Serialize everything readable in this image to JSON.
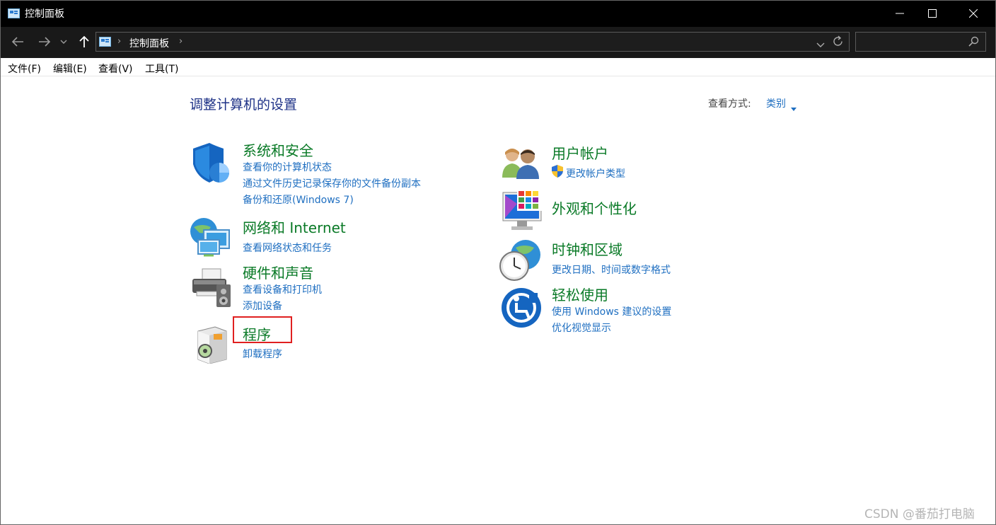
{
  "window": {
    "title": "控制面板"
  },
  "address": {
    "path": "控制面板"
  },
  "search": {
    "placeholder": ""
  },
  "menu": [
    "文件(F)",
    "编辑(E)",
    "查看(V)",
    "工具(T)"
  ],
  "content": {
    "heading": "调整计算机的设置",
    "view_label": "查看方式:",
    "view_value": "类别"
  },
  "categories": {
    "security": {
      "title": "系统和安全",
      "links": [
        "查看你的计算机状态",
        "通过文件历史记录保存你的文件备份副本",
        "备份和还原(Windows 7)"
      ]
    },
    "network": {
      "title": "网络和 Internet",
      "links": [
        "查看网络状态和任务"
      ]
    },
    "hardware": {
      "title": "硬件和声音",
      "links": [
        "查看设备和打印机",
        "添加设备"
      ]
    },
    "programs": {
      "title": "程序",
      "links": [
        "卸载程序"
      ]
    },
    "accounts": {
      "title": "用户帐户",
      "links": [
        "更改帐户类型"
      ]
    },
    "appearance": {
      "title": "外观和个性化",
      "links": []
    },
    "clock": {
      "title": "时钟和区域",
      "links": [
        "更改日期、时间或数字格式"
      ]
    },
    "ease": {
      "title": "轻松使用",
      "links": [
        "使用 Windows 建议的设置",
        "优化视觉显示"
      ]
    }
  },
  "watermark": "CSDN @番茄打电脑",
  "colors": {
    "link": "#1f6fc1",
    "category": "#0a7a27",
    "heading": "#1e3287",
    "highlight": "#e02020"
  }
}
